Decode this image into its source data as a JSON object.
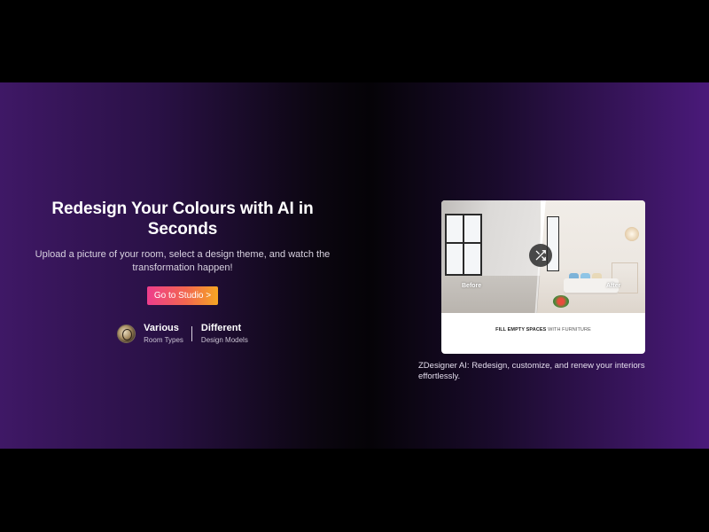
{
  "hero": {
    "headline": "Redesign Your Colours with AI in Seconds",
    "subheadline": "Upload a picture of your room, select a design theme, and watch the transformation happen!",
    "cta_label": "Go to Studio >",
    "stats": [
      {
        "title": "Various",
        "subtitle": "Room Types"
      },
      {
        "title": "Different",
        "subtitle": "Design Models"
      }
    ]
  },
  "preview_card": {
    "before_label": "Before",
    "after_label": "After",
    "caption_bold": "FILL EMPTY SPACES",
    "caption_rest": "WITH FURNITURE",
    "swap_icon": "shuffle-icon"
  },
  "right_caption": "ZDesigner AI: Redesign, customize, and renew your interiors effortlessly.",
  "colors": {
    "cta_gradient_start": "#ee3d8c",
    "cta_gradient_end": "#f5a623",
    "hero_purple": "#4a1a7a",
    "hero_dark": "#050307"
  }
}
